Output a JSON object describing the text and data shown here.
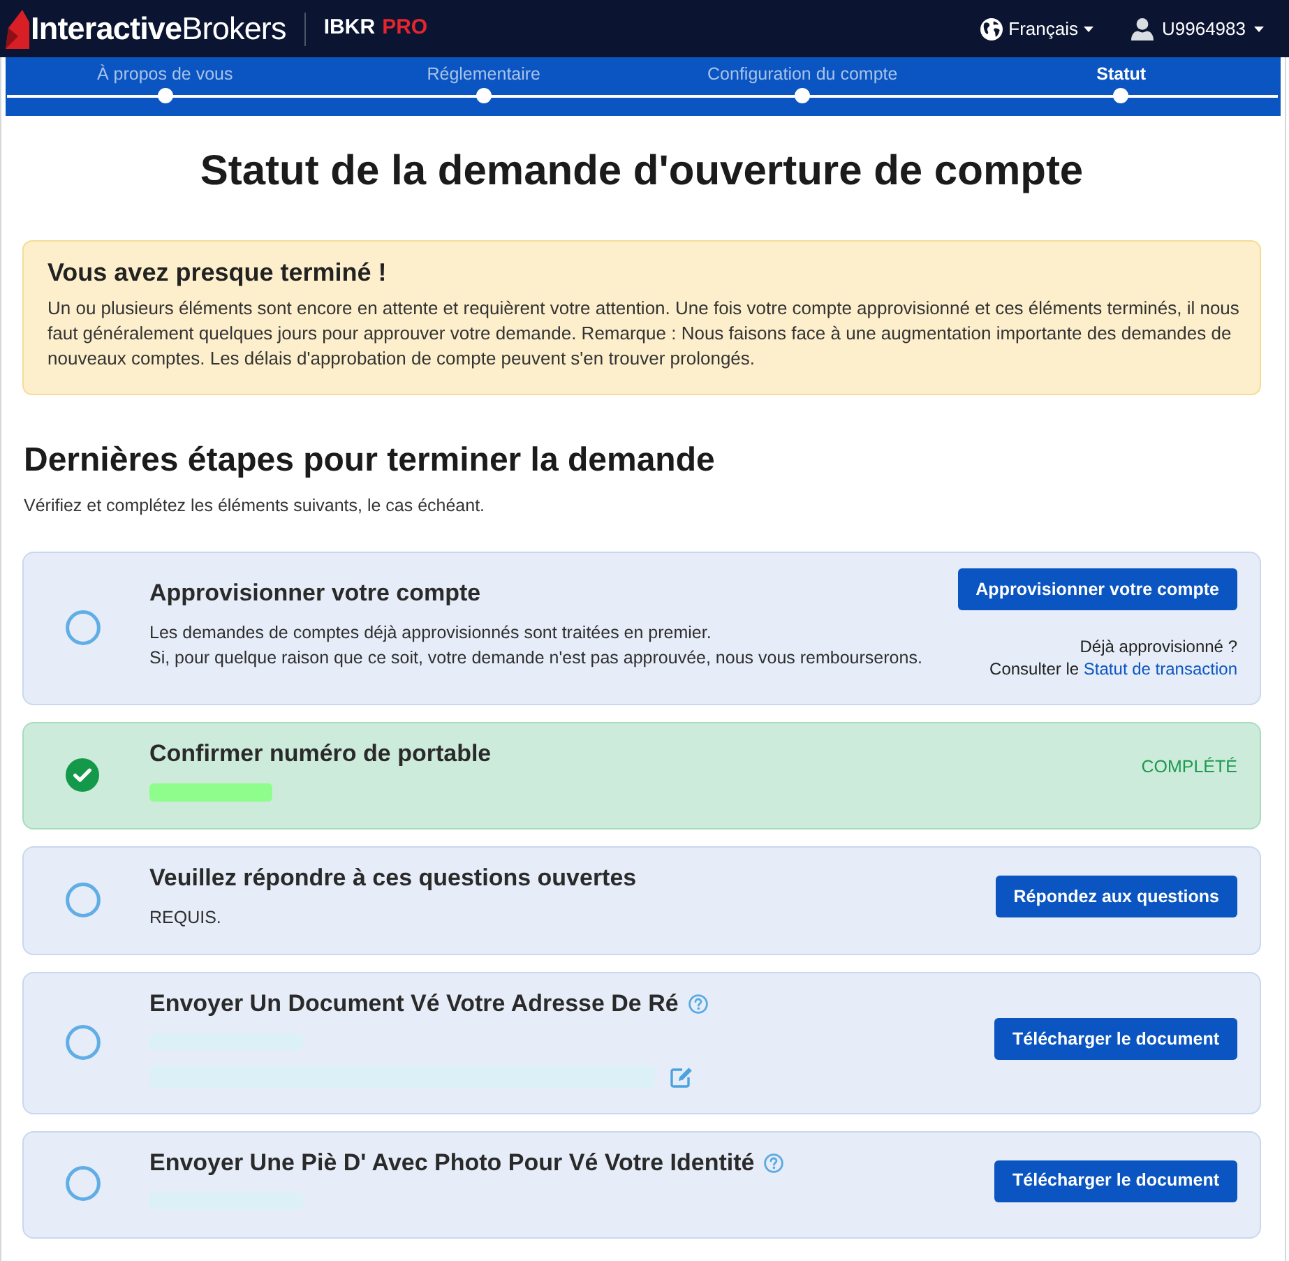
{
  "header": {
    "logo": "**Interactive**Brokers",
    "product": "IBKR",
    "tier": "PRO",
    "language": "Français",
    "account": "U9964983"
  },
  "steps": [
    {
      "label": "À propos de vous",
      "selected": false
    },
    {
      "label": "Réglementaire",
      "selected": false
    },
    {
      "label": "Configuration du compte",
      "selected": false
    },
    {
      "label": "Statut",
      "selected": true
    }
  ],
  "page_title": "Statut de la demande d'ouverture de compte",
  "alert": {
    "title": "Vous avez presque terminé !",
    "text": "Un ou plusieurs éléments sont encore en attente et requièrent votre attention. Une fois votre compte approvisionné et ces éléments terminés, il nous faut généralement quelques jours pour approuver votre demande. Remarque : Nous faisons face à une augmentation importante des demandes de nouveaux comptes. Les délais d'approbation de compte peuvent s'en trouver prolongés."
  },
  "section": {
    "title": "Dernières étapes pour terminer la demande",
    "subtitle": "Vérifiez et complétez les éléments suivants, le cas échéant."
  },
  "tasks": [
    {
      "title": "Approvisionner votre compte",
      "completed": false,
      "description": [
        "Les demandes de comptes déjà approvisionnés sont traitées en premier.",
        "Si, pour quelque raison que ce soit, votre demande n'est pas approuvée, nous vous rembourserons."
      ],
      "button": "Approvisionner votre compte",
      "note": {
        "question": "Déjà approvisionné ?",
        "prefix": "Consulter le",
        "link": "Statut de transaction"
      }
    },
    {
      "title": "Confirmer numéro de portable",
      "completed": true,
      "hidden_lines": [
        {
          "kind": "short",
          "color": "#8ffd8c"
        }
      ],
      "status_label": "COMPLÉTÉ"
    },
    {
      "title": "Veuillez répondre à ces questions ouvertes",
      "completed": false,
      "description": [
        "REQUIS."
      ],
      "button": "Répondez aux questions"
    },
    {
      "title": "Envoyer Un Document Vé Votre Adresse De Ré",
      "completed": false,
      "help": true,
      "hidden_lines": [
        {
          "kind": "medium",
          "color": "#dcf0f8"
        },
        {
          "kind": "long",
          "color": "#dcf0f8",
          "editable": true
        }
      ],
      "button": "Télécharger le document"
    },
    {
      "title": "Envoyer Une Piè D' Avec Photo Pour Vé Votre Identité",
      "completed": false,
      "help": true,
      "hidden_lines": [
        {
          "kind": "medium",
          "color": "#dcf0f8"
        }
      ],
      "button": "Télécharger le document"
    }
  ]
}
